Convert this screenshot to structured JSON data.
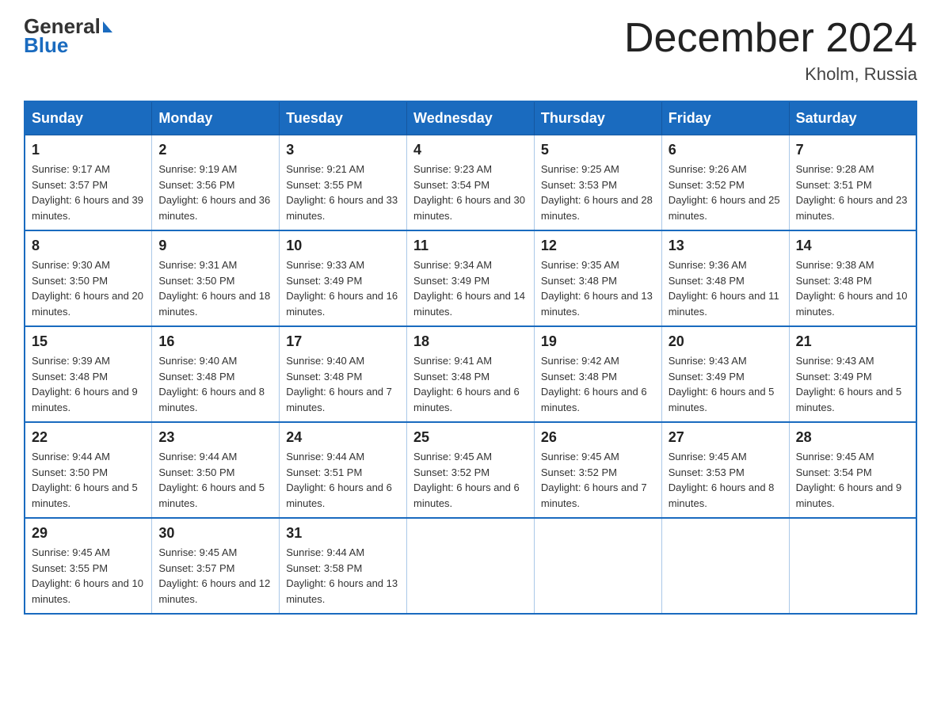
{
  "header": {
    "logo_general": "General",
    "logo_blue": "Blue",
    "title": "December 2024",
    "subtitle": "Kholm, Russia"
  },
  "calendar": {
    "days_of_week": [
      "Sunday",
      "Monday",
      "Tuesday",
      "Wednesday",
      "Thursday",
      "Friday",
      "Saturday"
    ],
    "weeks": [
      [
        {
          "day": "1",
          "sunrise": "Sunrise: 9:17 AM",
          "sunset": "Sunset: 3:57 PM",
          "daylight": "Daylight: 6 hours and 39 minutes."
        },
        {
          "day": "2",
          "sunrise": "Sunrise: 9:19 AM",
          "sunset": "Sunset: 3:56 PM",
          "daylight": "Daylight: 6 hours and 36 minutes."
        },
        {
          "day": "3",
          "sunrise": "Sunrise: 9:21 AM",
          "sunset": "Sunset: 3:55 PM",
          "daylight": "Daylight: 6 hours and 33 minutes."
        },
        {
          "day": "4",
          "sunrise": "Sunrise: 9:23 AM",
          "sunset": "Sunset: 3:54 PM",
          "daylight": "Daylight: 6 hours and 30 minutes."
        },
        {
          "day": "5",
          "sunrise": "Sunrise: 9:25 AM",
          "sunset": "Sunset: 3:53 PM",
          "daylight": "Daylight: 6 hours and 28 minutes."
        },
        {
          "day": "6",
          "sunrise": "Sunrise: 9:26 AM",
          "sunset": "Sunset: 3:52 PM",
          "daylight": "Daylight: 6 hours and 25 minutes."
        },
        {
          "day": "7",
          "sunrise": "Sunrise: 9:28 AM",
          "sunset": "Sunset: 3:51 PM",
          "daylight": "Daylight: 6 hours and 23 minutes."
        }
      ],
      [
        {
          "day": "8",
          "sunrise": "Sunrise: 9:30 AM",
          "sunset": "Sunset: 3:50 PM",
          "daylight": "Daylight: 6 hours and 20 minutes."
        },
        {
          "day": "9",
          "sunrise": "Sunrise: 9:31 AM",
          "sunset": "Sunset: 3:50 PM",
          "daylight": "Daylight: 6 hours and 18 minutes."
        },
        {
          "day": "10",
          "sunrise": "Sunrise: 9:33 AM",
          "sunset": "Sunset: 3:49 PM",
          "daylight": "Daylight: 6 hours and 16 minutes."
        },
        {
          "day": "11",
          "sunrise": "Sunrise: 9:34 AM",
          "sunset": "Sunset: 3:49 PM",
          "daylight": "Daylight: 6 hours and 14 minutes."
        },
        {
          "day": "12",
          "sunrise": "Sunrise: 9:35 AM",
          "sunset": "Sunset: 3:48 PM",
          "daylight": "Daylight: 6 hours and 13 minutes."
        },
        {
          "day": "13",
          "sunrise": "Sunrise: 9:36 AM",
          "sunset": "Sunset: 3:48 PM",
          "daylight": "Daylight: 6 hours and 11 minutes."
        },
        {
          "day": "14",
          "sunrise": "Sunrise: 9:38 AM",
          "sunset": "Sunset: 3:48 PM",
          "daylight": "Daylight: 6 hours and 10 minutes."
        }
      ],
      [
        {
          "day": "15",
          "sunrise": "Sunrise: 9:39 AM",
          "sunset": "Sunset: 3:48 PM",
          "daylight": "Daylight: 6 hours and 9 minutes."
        },
        {
          "day": "16",
          "sunrise": "Sunrise: 9:40 AM",
          "sunset": "Sunset: 3:48 PM",
          "daylight": "Daylight: 6 hours and 8 minutes."
        },
        {
          "day": "17",
          "sunrise": "Sunrise: 9:40 AM",
          "sunset": "Sunset: 3:48 PM",
          "daylight": "Daylight: 6 hours and 7 minutes."
        },
        {
          "day": "18",
          "sunrise": "Sunrise: 9:41 AM",
          "sunset": "Sunset: 3:48 PM",
          "daylight": "Daylight: 6 hours and 6 minutes."
        },
        {
          "day": "19",
          "sunrise": "Sunrise: 9:42 AM",
          "sunset": "Sunset: 3:48 PM",
          "daylight": "Daylight: 6 hours and 6 minutes."
        },
        {
          "day": "20",
          "sunrise": "Sunrise: 9:43 AM",
          "sunset": "Sunset: 3:49 PM",
          "daylight": "Daylight: 6 hours and 5 minutes."
        },
        {
          "day": "21",
          "sunrise": "Sunrise: 9:43 AM",
          "sunset": "Sunset: 3:49 PM",
          "daylight": "Daylight: 6 hours and 5 minutes."
        }
      ],
      [
        {
          "day": "22",
          "sunrise": "Sunrise: 9:44 AM",
          "sunset": "Sunset: 3:50 PM",
          "daylight": "Daylight: 6 hours and 5 minutes."
        },
        {
          "day": "23",
          "sunrise": "Sunrise: 9:44 AM",
          "sunset": "Sunset: 3:50 PM",
          "daylight": "Daylight: 6 hours and 5 minutes."
        },
        {
          "day": "24",
          "sunrise": "Sunrise: 9:44 AM",
          "sunset": "Sunset: 3:51 PM",
          "daylight": "Daylight: 6 hours and 6 minutes."
        },
        {
          "day": "25",
          "sunrise": "Sunrise: 9:45 AM",
          "sunset": "Sunset: 3:52 PM",
          "daylight": "Daylight: 6 hours and 6 minutes."
        },
        {
          "day": "26",
          "sunrise": "Sunrise: 9:45 AM",
          "sunset": "Sunset: 3:52 PM",
          "daylight": "Daylight: 6 hours and 7 minutes."
        },
        {
          "day": "27",
          "sunrise": "Sunrise: 9:45 AM",
          "sunset": "Sunset: 3:53 PM",
          "daylight": "Daylight: 6 hours and 8 minutes."
        },
        {
          "day": "28",
          "sunrise": "Sunrise: 9:45 AM",
          "sunset": "Sunset: 3:54 PM",
          "daylight": "Daylight: 6 hours and 9 minutes."
        }
      ],
      [
        {
          "day": "29",
          "sunrise": "Sunrise: 9:45 AM",
          "sunset": "Sunset: 3:55 PM",
          "daylight": "Daylight: 6 hours and 10 minutes."
        },
        {
          "day": "30",
          "sunrise": "Sunrise: 9:45 AM",
          "sunset": "Sunset: 3:57 PM",
          "daylight": "Daylight: 6 hours and 12 minutes."
        },
        {
          "day": "31",
          "sunrise": "Sunrise: 9:44 AM",
          "sunset": "Sunset: 3:58 PM",
          "daylight": "Daylight: 6 hours and 13 minutes."
        },
        null,
        null,
        null,
        null
      ]
    ]
  }
}
